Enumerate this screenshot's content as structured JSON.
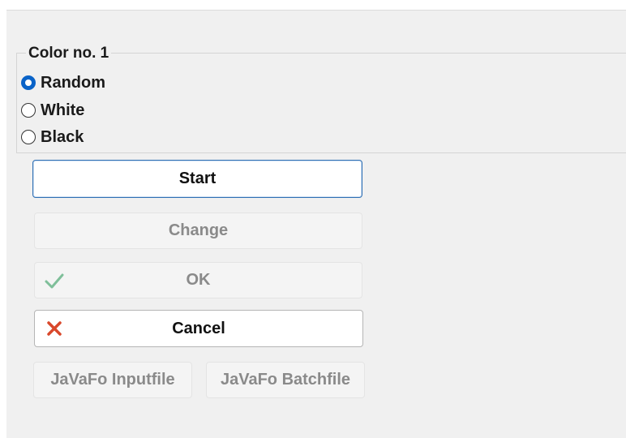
{
  "color_group": {
    "title": "Color no. 1",
    "options": [
      {
        "label": "Random",
        "selected": true
      },
      {
        "label": "White",
        "selected": false
      },
      {
        "label": "Black",
        "selected": false
      }
    ]
  },
  "buttons": {
    "start": {
      "label": "Start",
      "enabled": true
    },
    "change": {
      "label": "Change",
      "enabled": false
    },
    "ok": {
      "label": "OK",
      "enabled": false,
      "icon": "checkmark-icon"
    },
    "cancel": {
      "label": "Cancel",
      "enabled": true,
      "icon": "close-icon"
    },
    "javafo_inputfile": {
      "label": "JaVaFo Inputfile",
      "enabled": false
    },
    "javafo_batchfile": {
      "label": "JaVaFo Batchfile",
      "enabled": false
    }
  },
  "colors": {
    "accent": "#0a63c8",
    "default_button_border": "#2f6fb3",
    "ok_check": "#7fbf9a",
    "cancel_x": "#d9482b",
    "panel_bg": "#f0f0f0"
  }
}
